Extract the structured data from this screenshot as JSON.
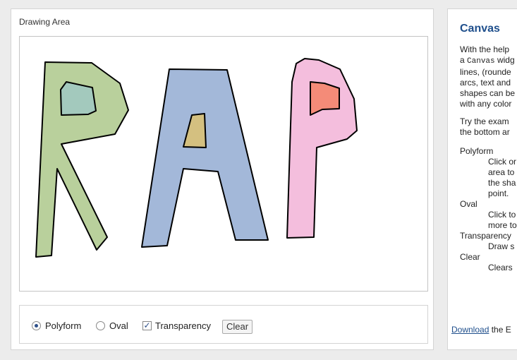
{
  "left_panel": {
    "title": "Drawing Area",
    "shape_colors": {
      "letter_r": "#b9d09c",
      "letter_r_hole": "#a3c9bd",
      "letter_a": "#a3b8d9",
      "letter_a_hole": "#d4c080",
      "letter_p": "#f4bedd",
      "letter_p_hole": "#f48b78",
      "outline": "#000000"
    }
  },
  "controls": {
    "polyform_label": "Polyform",
    "oval_label": "Oval",
    "transparency_label": "Transparency",
    "clear_label": "Clear",
    "selected_mode": "Polyform",
    "transparency_checked": true
  },
  "info_panel": {
    "title": "Canvas",
    "intro_lines": [
      "With the help",
      "a Canvas widg",
      "lines, (rounde",
      "arcs, text and",
      "shapes can be",
      "with any color"
    ],
    "try_lines": [
      "Try the exam",
      "the bottom ar"
    ],
    "polyform_term": "Polyform",
    "polyform_desc": [
      "Click or",
      "area to",
      "the sha",
      "point."
    ],
    "oval_term": "Oval",
    "oval_desc": [
      "Click to",
      "more to"
    ],
    "transparency_term": "Transparency",
    "transparency_desc": "Draw s",
    "clear_term": "Clear",
    "clear_desc": "Clears",
    "download_link": "Download",
    "download_rest": " the E"
  }
}
